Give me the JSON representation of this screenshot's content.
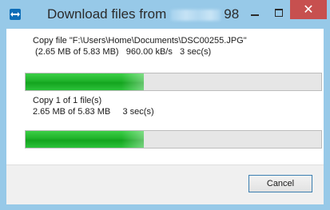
{
  "window": {
    "title": "Download files from",
    "title_suffix": "98",
    "close_symbol": "✕",
    "app_icon": "teamviewer-icon"
  },
  "current_file": {
    "line1": "Copy file \"F:\\Users\\Home\\Documents\\DSC00255.JPG\"",
    "line2": " (2.65 MB of 5.83 MB)   960.00 kB/s   3 sec(s)",
    "progress_fraction": 0.4
  },
  "overall": {
    "line1": "Copy 1 of 1 file(s)",
    "line2": "2.65 MB of 5.83 MB     3 sec(s)",
    "progress_fraction": 0.4
  },
  "footer": {
    "cancel_label": "Cancel"
  },
  "colors": {
    "titlebar": "#97c9e8",
    "close_button": "#c7504f",
    "progress_fill": "#1fb22a"
  }
}
